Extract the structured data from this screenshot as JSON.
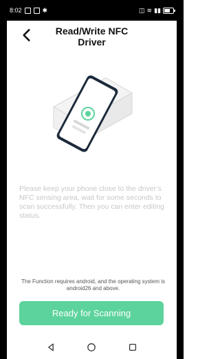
{
  "status_bar": {
    "time": "8:02",
    "icons_left": [
      "notification-icon",
      "image-icon",
      "bluetooth-icon"
    ],
    "icons_right": [
      "nfc-icon",
      "wifi-icon",
      "signal-icon",
      "battery-icon"
    ]
  },
  "header": {
    "title": "Read/Write NFC Driver",
    "back_icon": "chevron-left-icon"
  },
  "main": {
    "instruction": "Please keep your phone close to the driver’s NFC sensing area, wait for some seconds to scan successfully. Then you can enter editing status.",
    "requirement_note": "The Function requires android, and the operating system is android26 and above.",
    "scan_button_label": "Ready for Scanning"
  },
  "system_nav": {
    "back": "triangle-back-icon",
    "home": "circle-home-icon",
    "recent": "square-recent-icon"
  },
  "colors": {
    "button": "#5cd39c",
    "instruction_text": "#c7c7c7",
    "note_text": "#555555",
    "statusbar_bg": "#000000"
  }
}
